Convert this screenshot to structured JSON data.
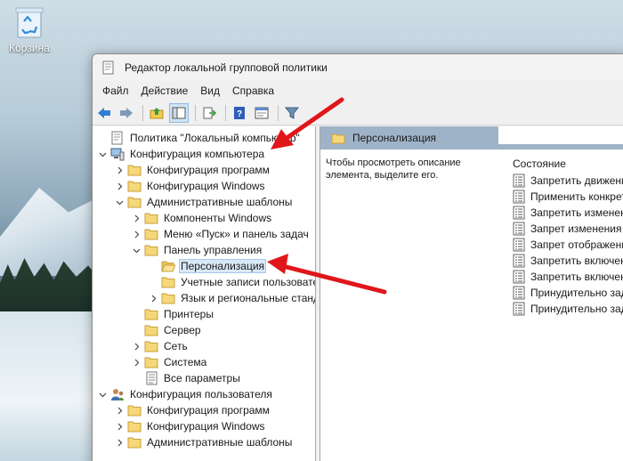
{
  "desktop": {
    "recycle_bin_label": "Корзина"
  },
  "window": {
    "title": "Редактор локальной групповой политики"
  },
  "menu": [
    "Файл",
    "Действие",
    "Вид",
    "Справка"
  ],
  "toolbar_icons": [
    "back-icon",
    "forward-icon",
    "up-folder-icon",
    "show-hide-tree-icon",
    "export-list-icon",
    "help-icon",
    "properties-icon",
    "filter-icon"
  ],
  "tree": [
    {
      "label": "Политика \"Локальный компьютер\"",
      "depth": 0,
      "chevron": "none",
      "icon": "policy"
    },
    {
      "label": "Конфигурация компьютера",
      "depth": 0,
      "chevron": "open",
      "icon": "computer"
    },
    {
      "label": "Конфигурация программ",
      "depth": 1,
      "chevron": "closed",
      "icon": "folder"
    },
    {
      "label": "Конфигурация Windows",
      "depth": 1,
      "chevron": "closed",
      "icon": "folder"
    },
    {
      "label": "Административные шаблоны",
      "depth": 1,
      "chevron": "open",
      "icon": "folder"
    },
    {
      "label": "Компоненты Windows",
      "depth": 2,
      "chevron": "closed",
      "icon": "folder"
    },
    {
      "label": "Меню «Пуск» и панель задач",
      "depth": 2,
      "chevron": "closed",
      "icon": "folder"
    },
    {
      "label": "Панель управления",
      "depth": 2,
      "chevron": "open",
      "icon": "folder"
    },
    {
      "label": "Персонализация",
      "depth": 3,
      "chevron": "none",
      "icon": "folder-open",
      "selected": true
    },
    {
      "label": "Учетные записи пользователей",
      "depth": 3,
      "chevron": "none",
      "icon": "folder"
    },
    {
      "label": "Язык и региональные стандарты",
      "depth": 3,
      "chevron": "closed",
      "icon": "folder"
    },
    {
      "label": "Принтеры",
      "depth": 2,
      "chevron": "none",
      "icon": "folder"
    },
    {
      "label": "Сервер",
      "depth": 2,
      "chevron": "none",
      "icon": "folder"
    },
    {
      "label": "Сеть",
      "depth": 2,
      "chevron": "closed",
      "icon": "folder"
    },
    {
      "label": "Система",
      "depth": 2,
      "chevron": "closed",
      "icon": "folder"
    },
    {
      "label": "Все параметры",
      "depth": 2,
      "chevron": "none",
      "icon": "all-settings"
    },
    {
      "label": "Конфигурация пользователя",
      "depth": 0,
      "chevron": "open",
      "icon": "user"
    },
    {
      "label": "Конфигурация программ",
      "depth": 1,
      "chevron": "closed",
      "icon": "folder"
    },
    {
      "label": "Конфигурация Windows",
      "depth": 1,
      "chevron": "closed",
      "icon": "folder"
    },
    {
      "label": "Административные шаблоны",
      "depth": 1,
      "chevron": "closed",
      "icon": "folder"
    }
  ],
  "right_pane": {
    "header": "Персонализация",
    "description": "Чтобы просмотреть описание элемента, выделите его.",
    "column_header": "Состояние",
    "settings": [
      "Запретить движение",
      "Применить конкрет",
      "Запретить изменени",
      "Запрет изменения ф",
      "Запрет отображени",
      "Запретить включени",
      "Запретить включени",
      "Принудительно зад",
      "Принудительно зад"
    ]
  },
  "colors": {
    "annotation_arrow": "#e0161b",
    "header_band": "#9fb3c8",
    "selection": "#d9e8f7"
  }
}
